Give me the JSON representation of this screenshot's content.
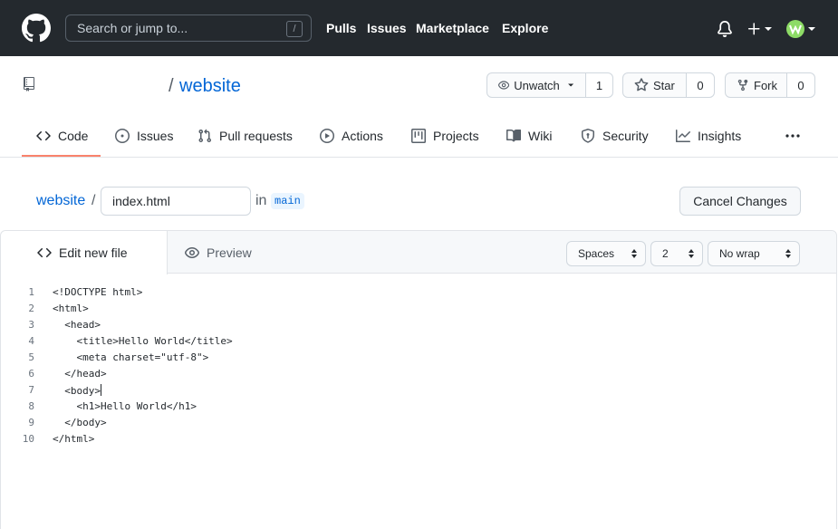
{
  "header": {
    "search_placeholder": "Search or jump to...",
    "search_shortcut": "/",
    "nav": [
      "Pulls",
      "Issues",
      "Marketplace",
      "Explore"
    ]
  },
  "repo": {
    "owner": "",
    "separator": "/",
    "name": "website",
    "watch": {
      "label": "Unwatch",
      "count": "1"
    },
    "star": {
      "label": "Star",
      "count": "0"
    },
    "fork": {
      "label": "Fork",
      "count": "0"
    }
  },
  "tabs": [
    {
      "label": "Code",
      "icon": "code-icon"
    },
    {
      "label": "Issues",
      "icon": "issue-icon"
    },
    {
      "label": "Pull requests",
      "icon": "pull-request-icon"
    },
    {
      "label": "Actions",
      "icon": "play-icon"
    },
    {
      "label": "Projects",
      "icon": "project-icon"
    },
    {
      "label": "Wiki",
      "icon": "book-icon"
    },
    {
      "label": "Security",
      "icon": "shield-icon"
    },
    {
      "label": "Insights",
      "icon": "graph-icon"
    }
  ],
  "edit": {
    "breadcrumb_repo": "website",
    "breadcrumb_sep": "/",
    "filename": "index.html",
    "in_label": "in",
    "branch": "main",
    "cancel_label": "Cancel Changes"
  },
  "editor": {
    "tab_edit": "Edit new file",
    "tab_preview": "Preview",
    "indent_mode": "Spaces",
    "indent_size": "2",
    "wrap_mode": "No wrap",
    "lines": [
      "<!DOCTYPE html>",
      "<html>",
      "  <head>",
      "    <title>Hello World</title>",
      "    <meta charset=\"utf-8\">",
      "  </head>",
      "  <body>",
      "    <h1>Hello World</h1>",
      "  </body>",
      "</html>"
    ],
    "line_numbers": [
      "1",
      "2",
      "3",
      "4",
      "5",
      "6",
      "7",
      "8",
      "9",
      "10"
    ]
  },
  "colors": {
    "header_bg": "#24292e",
    "link": "#0366d6",
    "active_tab_underline": "#f9826c"
  }
}
